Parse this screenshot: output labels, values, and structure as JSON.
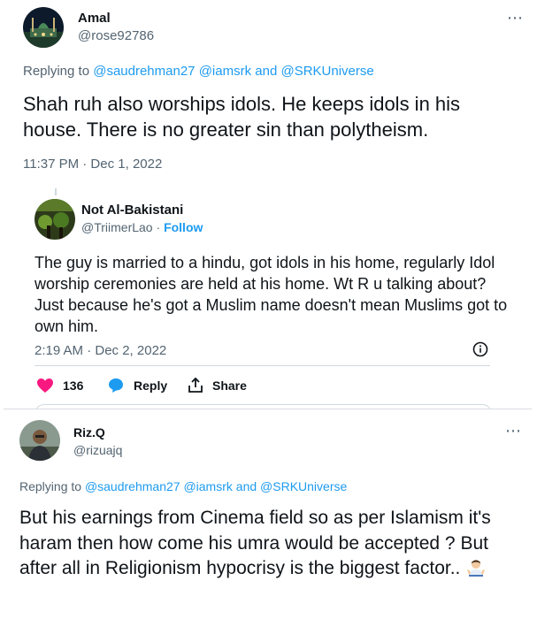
{
  "tweet1": {
    "name": "Amal",
    "handle": "@rose92786",
    "more_icon": "⋯",
    "replying_prefix": "Replying to",
    "mentions": [
      "@saudrehman27",
      "@iamsrk",
      "and",
      "@SRKUniverse"
    ],
    "text": "Shah ruh also worships idols. He keeps idols in his house.  There is no greater sin than polytheism.",
    "timestamp": "11:37 PM · Dec 1, 2022"
  },
  "quoted": {
    "name": "Not Al-Bakistani",
    "handle": "@TriimerLao",
    "separator": "·",
    "follow_label": "Follow",
    "text": "The guy is married to a hindu, got idols in his home, regularly Idol worship ceremonies are held at his home. Wt R u talking about? Just because he's got a Muslim name doesn't mean Muslims got to own him.",
    "timestamp": "2:19 AM · Dec 2, 2022",
    "likes": "136",
    "reply_label": "Reply",
    "share_label": "Share"
  },
  "tweet2": {
    "name": "Riz.Q",
    "handle": "@rizuajq",
    "more_icon": "⋯",
    "replying_prefix": "Replying to",
    "mentions": [
      "@saudrehman27",
      "@iamsrk",
      "and",
      "@SRKUniverse"
    ],
    "text": "But his earnings from Cinema field so  as per Islamism it's haram then how come his umra would be accepted ? But after all in Religionism hypocrisy is the biggest factor.."
  },
  "colors": {
    "link": "#1d9bf0",
    "like": "#f91880",
    "secondary": "#536471",
    "text": "#0f1419"
  }
}
